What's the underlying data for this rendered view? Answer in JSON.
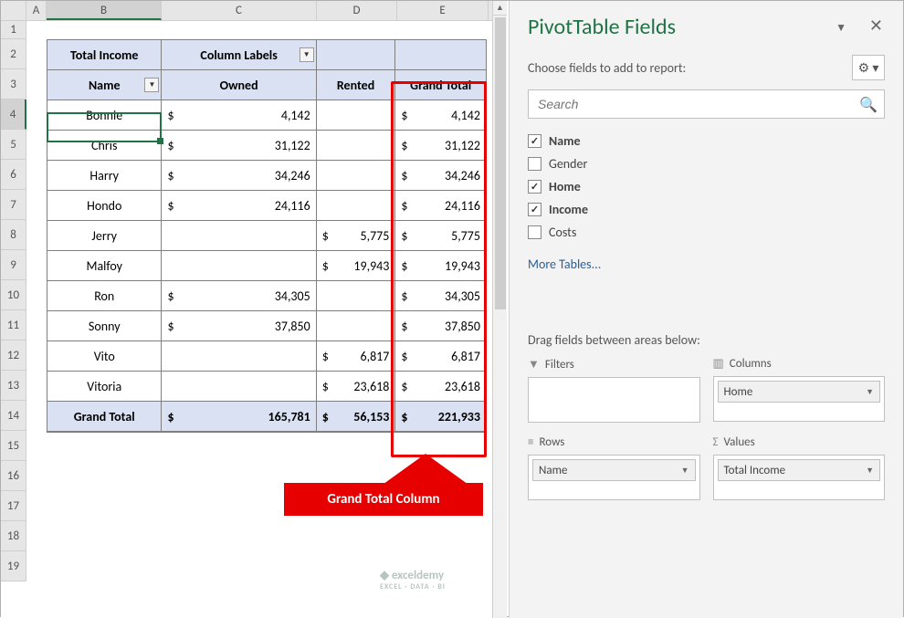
{
  "cols": [
    "A",
    "B",
    "C",
    "D",
    "E"
  ],
  "rows": [
    "1",
    "2",
    "3",
    "4",
    "5",
    "6",
    "7",
    "8",
    "9",
    "10",
    "11",
    "12",
    "13",
    "14",
    "15",
    "16",
    "17",
    "18",
    "19"
  ],
  "selected_col": "B",
  "selected_row": "4",
  "pivot": {
    "h1_b": "Total Income",
    "h1_c": "Column Labels",
    "h2_b": "Name",
    "h2_c": "Owned",
    "h2_d": "Rented",
    "h2_e": "Grand Total",
    "rows": [
      {
        "name": "Bonnie",
        "owned": "4,142",
        "rented": "",
        "total": "4,142"
      },
      {
        "name": "Chris",
        "owned": "31,122",
        "rented": "",
        "total": "31,122"
      },
      {
        "name": "Harry",
        "owned": "34,246",
        "rented": "",
        "total": "34,246"
      },
      {
        "name": "Hondo",
        "owned": "24,116",
        "rented": "",
        "total": "24,116"
      },
      {
        "name": "Jerry",
        "owned": "",
        "rented": "5,775",
        "total": "5,775"
      },
      {
        "name": "Malfoy",
        "owned": "",
        "rented": "19,943",
        "total": "19,943"
      },
      {
        "name": "Ron",
        "owned": "34,305",
        "rented": "",
        "total": "34,305"
      },
      {
        "name": "Sonny",
        "owned": "37,850",
        "rented": "",
        "total": "37,850"
      },
      {
        "name": "Vito",
        "owned": "",
        "rented": "6,817",
        "total": "6,817"
      },
      {
        "name": "Vitoria",
        "owned": "",
        "rented": "23,618",
        "total": "23,618"
      }
    ],
    "grand": {
      "label": "Grand Total",
      "owned": "165,781",
      "rented": "56,153",
      "total": "221,933"
    }
  },
  "callout": "Grand Total Column",
  "watermark": {
    "main": "exceldemy",
    "sub": "EXCEL · DATA · BI"
  },
  "panel": {
    "title": "PivotTable Fields",
    "choose": "Choose fields to add to report:",
    "search_ph": "Search",
    "fields": [
      {
        "label": "Name",
        "checked": true
      },
      {
        "label": "Gender",
        "checked": false
      },
      {
        "label": "Home",
        "checked": true
      },
      {
        "label": "Income",
        "checked": true
      },
      {
        "label": "Costs",
        "checked": false
      }
    ],
    "more": "More Tables...",
    "drag": "Drag fields between areas below:",
    "areas": {
      "filters": {
        "title": "Filters",
        "pills": []
      },
      "columns": {
        "title": "Columns",
        "pills": [
          "Home"
        ]
      },
      "rows": {
        "title": "Rows",
        "pills": [
          "Name"
        ]
      },
      "values": {
        "title": "Values",
        "pills": [
          "Total Income"
        ]
      }
    }
  },
  "chart_data": {
    "type": "table",
    "title": "Total Income",
    "column_field": "Home",
    "row_field": "Name",
    "value_field": "Income",
    "columns": [
      "Owned",
      "Rented",
      "Grand Total"
    ],
    "rows": [
      {
        "Name": "Bonnie",
        "Owned": 4142,
        "Rented": null,
        "Grand Total": 4142
      },
      {
        "Name": "Chris",
        "Owned": 31122,
        "Rented": null,
        "Grand Total": 31122
      },
      {
        "Name": "Harry",
        "Owned": 34246,
        "Rented": null,
        "Grand Total": 34246
      },
      {
        "Name": "Hondo",
        "Owned": 24116,
        "Rented": null,
        "Grand Total": 24116
      },
      {
        "Name": "Jerry",
        "Owned": null,
        "Rented": 5775,
        "Grand Total": 5775
      },
      {
        "Name": "Malfoy",
        "Owned": null,
        "Rented": 19943,
        "Grand Total": 19943
      },
      {
        "Name": "Ron",
        "Owned": 34305,
        "Rented": null,
        "Grand Total": 34305
      },
      {
        "Name": "Sonny",
        "Owned": 37850,
        "Rented": null,
        "Grand Total": 37850
      },
      {
        "Name": "Vito",
        "Owned": null,
        "Rented": 6817,
        "Grand Total": 6817
      },
      {
        "Name": "Vitoria",
        "Owned": null,
        "Rented": 23618,
        "Grand Total": 23618
      }
    ],
    "grand_total": {
      "Owned": 165781,
      "Rented": 56153,
      "Grand Total": 221933
    }
  }
}
